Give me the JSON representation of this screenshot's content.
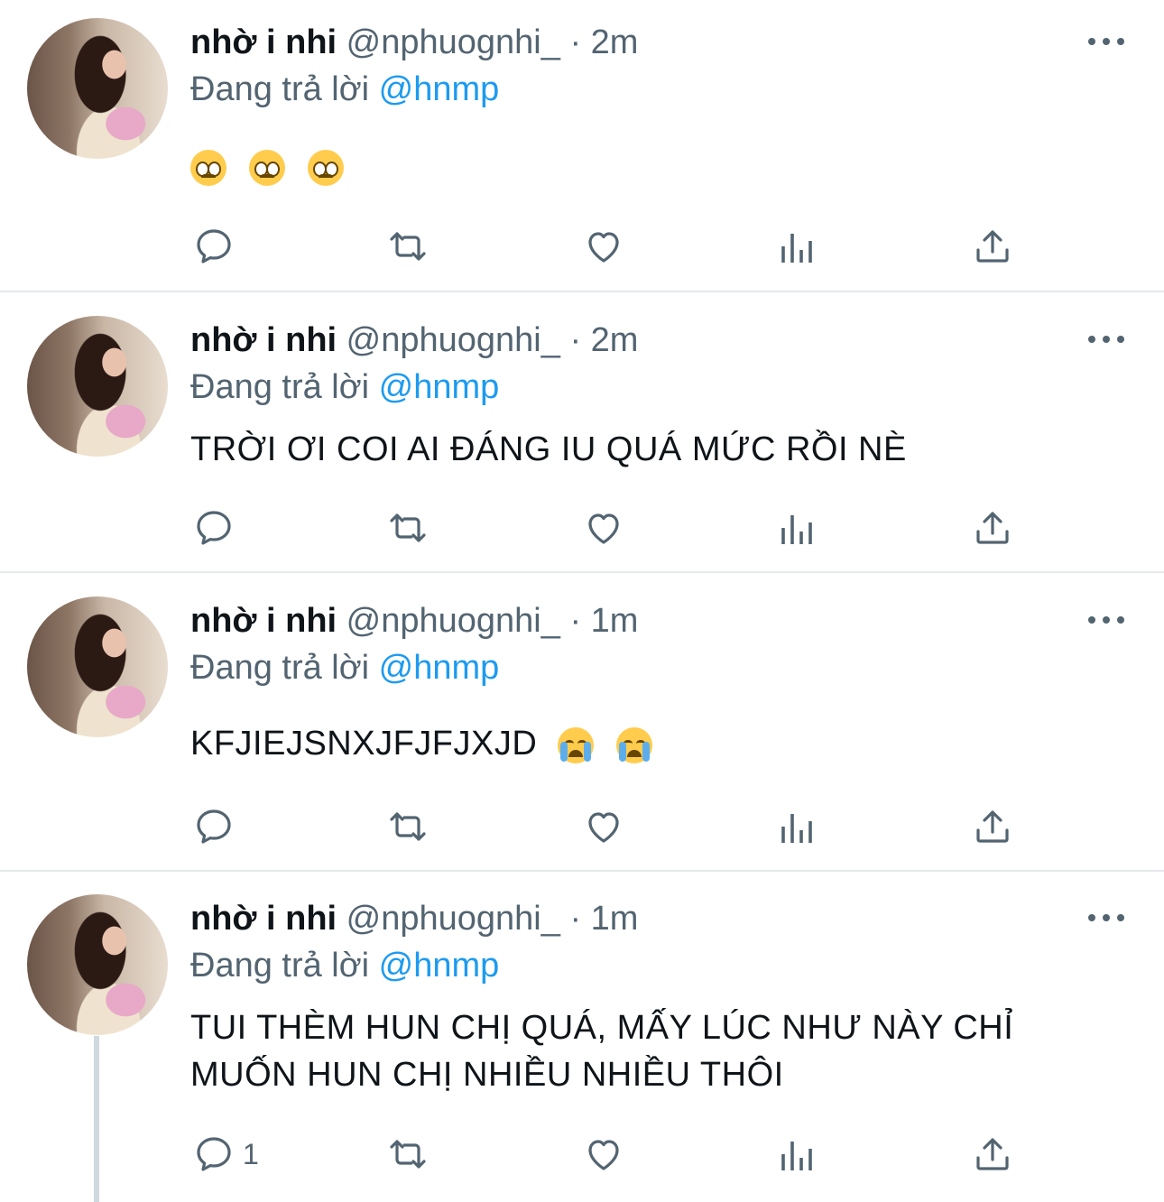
{
  "tweets": [
    {
      "name": "nhờ i nhi",
      "handle": "@nphuognhi_",
      "dot": "·",
      "time": "2m",
      "reply_prefix": "Đang trả lời",
      "reply_to": "@hnmp",
      "text": "",
      "emojis": [
        "pleading-face-emoji",
        "pleading-face-emoji",
        "pleading-face-emoji"
      ],
      "reply_count": ""
    },
    {
      "name": "nhờ i nhi",
      "handle": "@nphuognhi_",
      "dot": "·",
      "time": "2m",
      "reply_prefix": "Đang trả lời",
      "reply_to": "@hnmp",
      "text": "TRỜI ƠI COI AI ĐÁNG IU QUÁ MỨC RỒI NÈ",
      "emojis": [],
      "reply_count": ""
    },
    {
      "name": "nhờ i nhi",
      "handle": "@nphuognhi_",
      "dot": "·",
      "time": "1m",
      "reply_prefix": "Đang trả lời",
      "reply_to": "@hnmp",
      "text": "KFJIEJSNXJFJFJXJD",
      "emojis": [
        "loudly-crying-face-emoji",
        "loudly-crying-face-emoji"
      ],
      "reply_count": ""
    },
    {
      "name": "nhờ i nhi",
      "handle": "@nphuognhi_",
      "dot": "·",
      "time": "1m",
      "reply_prefix": "Đang trả lời",
      "reply_to": "@hnmp",
      "text": "TUI THÈM HUN CHỊ QUÁ, MẤY LÚC NHƯ NÀY CHỈ MUỐN HUN CHỊ NHIỀU NHIỀU THÔI",
      "emojis": [],
      "reply_count": "1"
    }
  ],
  "icons": {
    "reply": "reply-icon",
    "retweet": "retweet-icon",
    "like": "heart-icon",
    "analytics": "analytics-icon",
    "share": "share-icon",
    "more": "more-icon"
  },
  "colors": {
    "text": "#0f1419",
    "secondary": "#536471",
    "link": "#1d9bf0",
    "divider": "#e6e9eb"
  }
}
